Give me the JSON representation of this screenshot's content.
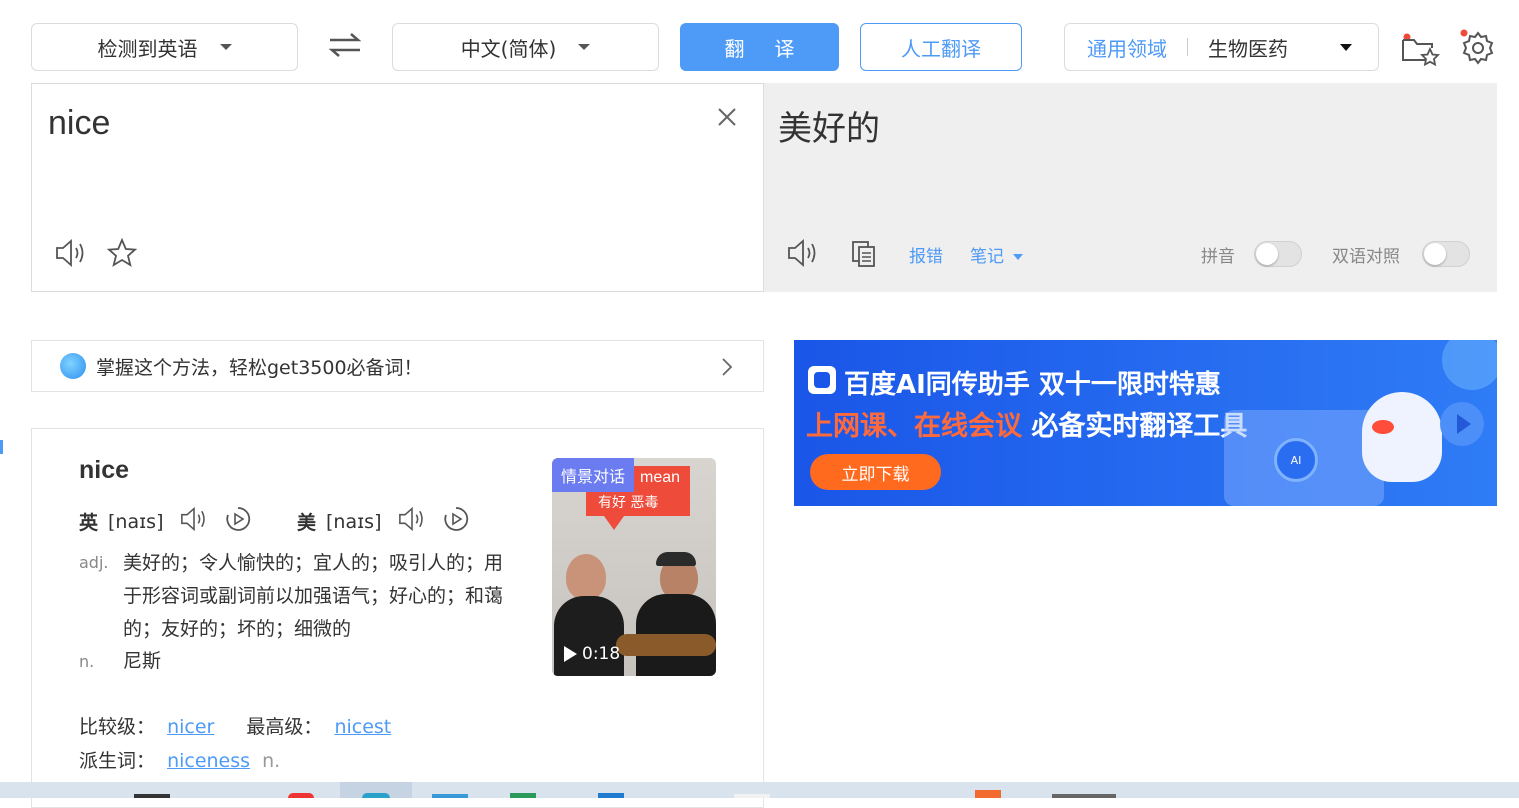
{
  "top_bar": {
    "source_lang": "检测到英语",
    "target_lang": "中文(简体)",
    "translate_button": "翻译",
    "human_translate_button": "人工翻译",
    "domain_general": "通用领域",
    "domain_selected": "生物医药"
  },
  "input": {
    "text": "nice"
  },
  "output": {
    "text": "美好的",
    "report_error": "报错",
    "notes": "笔记",
    "pinyin_label": "拼音",
    "bilingual_label": "双语对照"
  },
  "promo": {
    "text": "掌握这个方法，轻松get3500必备词！"
  },
  "dictionary": {
    "word": "nice",
    "uk_label": "英",
    "uk_ipa": "[naɪs]",
    "us_label": "美",
    "us_ipa": "[naɪs]",
    "pos_adj": "adj.",
    "def_adj": "美好的；令人愉快的；宜人的；吸引人的；用于形容词或副词前以加强语气；好心的；和蔼的；友好的；坏的；细微的",
    "pos_n": "n.",
    "def_n": "尼斯",
    "comparative_label": "比较级：",
    "comparative": "nicer",
    "superlative_label": "最高级：",
    "superlative": "nicest",
    "derivative_label": "派生词：",
    "derivative": "niceness",
    "derivative_pos": "n."
  },
  "video": {
    "tag": "情景对话",
    "caption_top": "mean",
    "caption_cn": "有好 恶毒",
    "duration": "0:18"
  },
  "ad": {
    "title": "百度AI同传助手 双十一限时特惠",
    "subtitle_highlight": "上网课、在线会议",
    "subtitle_rest": "必备实时翻译工具",
    "button": "立即下载",
    "ai_badge": "AI"
  },
  "colors": {
    "accent": "#4e9af7",
    "ad_blue": "#1a56e8",
    "ad_orange": "#ff6a1f"
  }
}
